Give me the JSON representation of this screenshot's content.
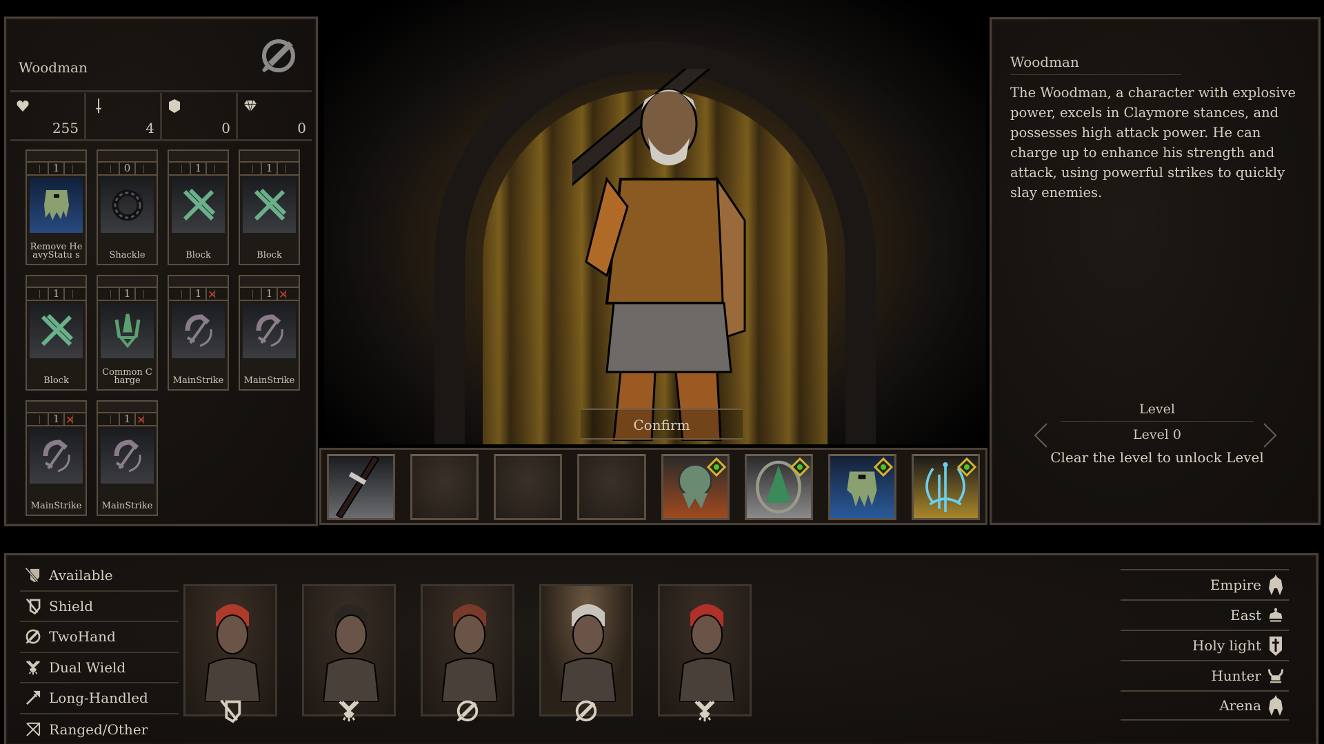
{
  "hero": {
    "name": "Woodman",
    "class_icon": "twohand-sword-icon",
    "stats": [
      {
        "icon": "heart-icon",
        "label": "health",
        "value": "255"
      },
      {
        "icon": "sword-icon",
        "label": "attack",
        "value": "4"
      },
      {
        "icon": "shield-icon",
        "label": "defense",
        "value": "0"
      },
      {
        "icon": "diamond-icon",
        "label": "gem",
        "value": "0"
      }
    ]
  },
  "cards": [
    {
      "name": "Remove HeavyStatus",
      "display": "Remove HeavyStatu s",
      "cost": "1",
      "locked": false,
      "art": "blue",
      "icon": "slime-icon"
    },
    {
      "name": "Shackle",
      "display": "Shackle",
      "cost": "0",
      "locked": false,
      "art": "grey",
      "icon": "shackle-icon"
    },
    {
      "name": "Block",
      "display": "Block",
      "cost": "1",
      "locked": false,
      "art": "grey",
      "icon": "block-icon"
    },
    {
      "name": "Block",
      "display": "Block",
      "cost": "1",
      "locked": false,
      "art": "grey",
      "icon": "block-icon"
    },
    {
      "name": "Block",
      "display": "Block",
      "cost": "1",
      "locked": false,
      "art": "grey",
      "icon": "block-icon"
    },
    {
      "name": "Common Charge",
      "display": "Common Charge",
      "cost": "1",
      "locked": false,
      "art": "grey",
      "icon": "charge-icon"
    },
    {
      "name": "MainStrike",
      "display": "MainStrike",
      "cost": "1",
      "locked": true,
      "art": "grey",
      "icon": "mainstrike-icon"
    },
    {
      "name": "MainStrike",
      "display": "MainStrike",
      "cost": "1",
      "locked": true,
      "art": "grey",
      "icon": "mainstrike-icon"
    },
    {
      "name": "MainStrike",
      "display": "MainStrike",
      "cost": "1",
      "locked": true,
      "art": "grey",
      "icon": "mainstrike-icon"
    },
    {
      "name": "MainStrike",
      "display": "MainStrike",
      "cost": "1",
      "locked": true,
      "art": "grey",
      "icon": "mainstrike-icon"
    }
  ],
  "confirm_label": "Confirm",
  "equipment_slots": [
    {
      "type": "weapon",
      "icon": "greatsword-icon",
      "swappable": false
    },
    {
      "type": "empty",
      "icon": "",
      "swappable": false
    },
    {
      "type": "empty",
      "icon": "",
      "swappable": false
    },
    {
      "type": "empty",
      "icon": "",
      "swappable": false
    },
    {
      "type": "orange",
      "icon": "tree-stump-icon",
      "swappable": true
    },
    {
      "type": "grey",
      "icon": "pine-tree-icon",
      "swappable": true
    },
    {
      "type": "blue",
      "icon": "slime-icon",
      "swappable": true
    },
    {
      "type": "gold",
      "icon": "rune-icon",
      "swappable": true
    }
  ],
  "description": {
    "title": "Woodman",
    "text": "The Woodman, a character with explosive power, excels in Claymore stances, and possesses high attack power. He can charge up to enhance his strength and attack, using powerful strikes to quickly slay enemies."
  },
  "level": {
    "heading": "Level",
    "value": "Level 0",
    "hint": "Clear the level to unlock Level"
  },
  "filters": [
    {
      "label": "Available",
      "icon": "available-icon"
    },
    {
      "label": "Shield",
      "icon": "shield-sword-icon"
    },
    {
      "label": "TwoHand",
      "icon": "twohand-sword-icon"
    },
    {
      "label": "Dual Wield",
      "icon": "dual-wield-icon"
    },
    {
      "label": "Long-Handled",
      "icon": "polearm-icon"
    },
    {
      "label": "Ranged/Other",
      "icon": "bow-icon"
    }
  ],
  "roster": [
    {
      "name": "red-haired-brawler",
      "weapon": "shield-sword-icon",
      "selected": false,
      "hair": "#b03a2a"
    },
    {
      "name": "hooded-rogue",
      "weapon": "dual-wield-icon",
      "selected": false,
      "hair": "#2a2622"
    },
    {
      "name": "bearded-warrior",
      "weapon": "twohand-sword-icon",
      "selected": false,
      "hair": "#7a3a2a"
    },
    {
      "name": "woodman",
      "weapon": "twohand-sword-icon",
      "selected": true,
      "hair": "#c8c4bc"
    },
    {
      "name": "berserker",
      "weapon": "dual-wield-icon",
      "selected": false,
      "hair": "#b0302a"
    }
  ],
  "factions": [
    {
      "label": "Empire",
      "icon": "helmet-icon"
    },
    {
      "label": "East",
      "icon": "crown-icon"
    },
    {
      "label": "Holy light",
      "icon": "cross-shield-icon"
    },
    {
      "label": "Hunter",
      "icon": "horned-helmet-icon"
    },
    {
      "label": "Arena",
      "icon": "helmet-icon"
    }
  ],
  "colors": {
    "text": "#d6cfc0",
    "border": "#4a4035",
    "lock_x": "#d83a2a",
    "swap_badge": "#d4b430",
    "swap_arrow": "#4ac62a"
  }
}
